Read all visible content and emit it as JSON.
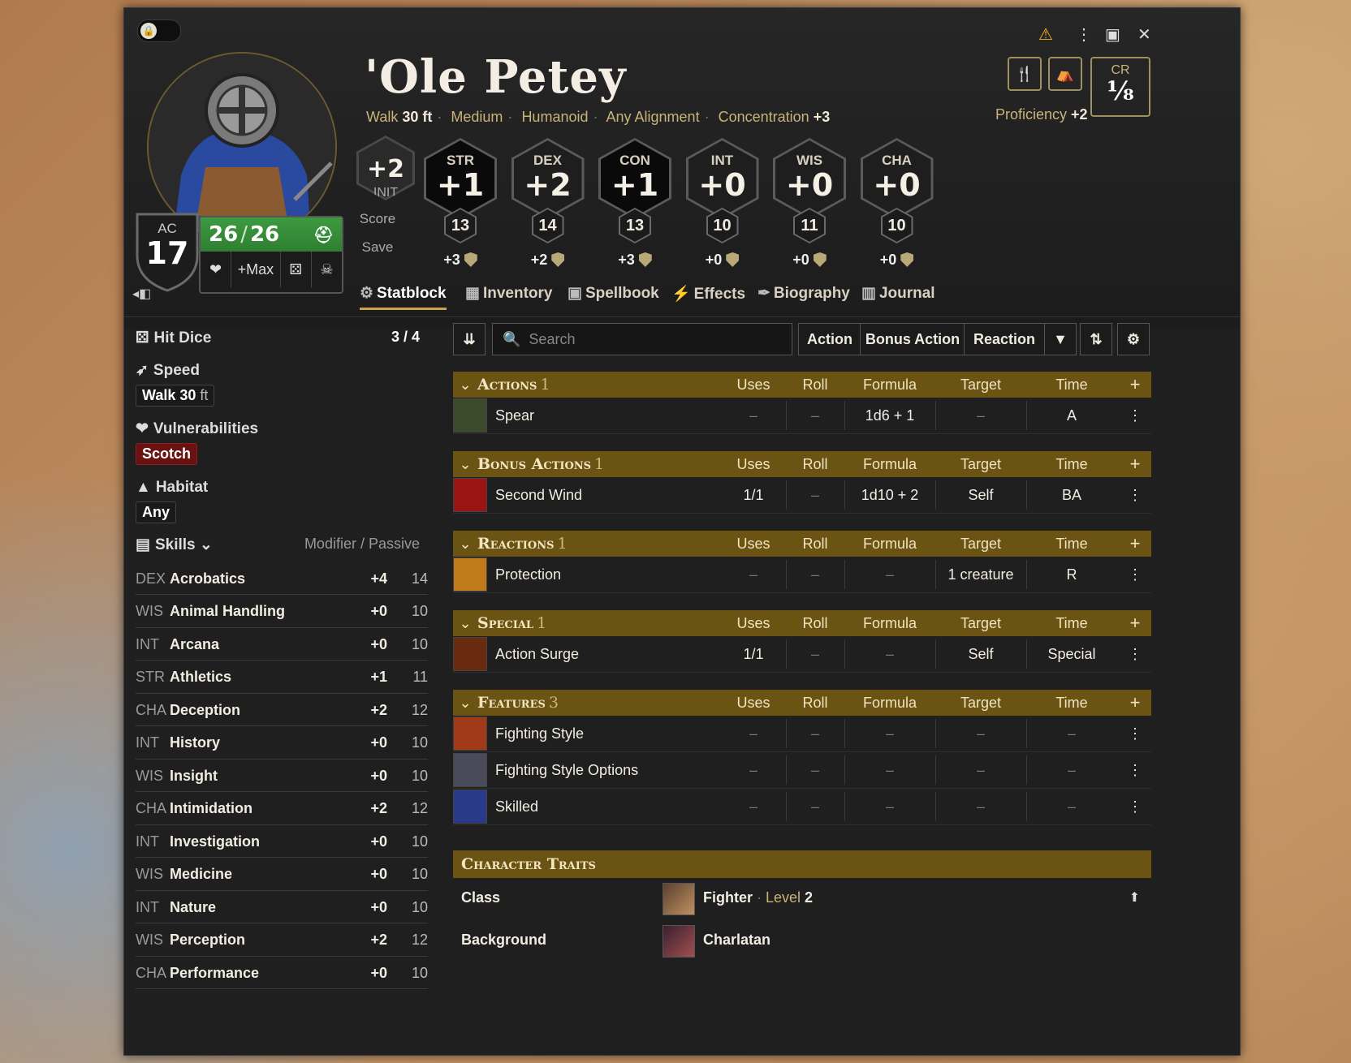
{
  "header": {
    "name": "'Ole Petey",
    "subline": {
      "walk_label": "Walk",
      "walk_value": "30 ft",
      "size": "Medium",
      "type": "Humanoid",
      "alignment": "Any Alignment",
      "concentration_label": "Concentration",
      "concentration_value": "+3"
    },
    "proficiency_label": "Proficiency",
    "proficiency_value": "+2",
    "cr_label": "CR",
    "cr_value": "⅛",
    "ac_label": "AC",
    "ac_value": "17",
    "hp_current": "26",
    "hp_sep": "/",
    "hp_max": "26",
    "hp_max_btn": "+Max",
    "init_value": "+2",
    "init_label": "INIT",
    "score_label": "Score",
    "save_label": "Save",
    "abilities": [
      {
        "abbr": "STR",
        "mod": "+1",
        "score": "13",
        "save": "+3",
        "proficient": true
      },
      {
        "abbr": "DEX",
        "mod": "+2",
        "score": "14",
        "save": "+2",
        "proficient": false
      },
      {
        "abbr": "CON",
        "mod": "+1",
        "score": "13",
        "save": "+3",
        "proficient": true
      },
      {
        "abbr": "INT",
        "mod": "+0",
        "score": "10",
        "save": "+0",
        "proficient": false
      },
      {
        "abbr": "WIS",
        "mod": "+0",
        "score": "11",
        "save": "+0",
        "proficient": false
      },
      {
        "abbr": "CHA",
        "mod": "+0",
        "score": "10",
        "save": "+0",
        "proficient": false
      }
    ]
  },
  "tabs": [
    {
      "label": "Statblock",
      "icon": "gear-icon",
      "active": true
    },
    {
      "label": "Inventory",
      "icon": "backpack-icon"
    },
    {
      "label": "Spellbook",
      "icon": "book-icon"
    },
    {
      "label": "Effects",
      "icon": "bolt-icon"
    },
    {
      "label": "Biography",
      "icon": "feather-icon"
    },
    {
      "label": "Journal",
      "icon": "journal-icon"
    }
  ],
  "sidebar": {
    "hit_dice_label": "Hit Dice",
    "hit_dice_value": "3 / 4",
    "speed_label": "Speed",
    "speed_walk": "Walk",
    "speed_value": "30",
    "speed_unit": "ft",
    "vulnerabilities_label": "Vulnerabilities",
    "vulnerability": "Scotch",
    "habitat_label": "Habitat",
    "habitat": "Any",
    "skills_label": "Skills",
    "skills_cols": "Modifier / Passive",
    "skills": [
      {
        "ab": "DEX",
        "name": "Acrobatics",
        "mod": "+4",
        "passive": "14"
      },
      {
        "ab": "WIS",
        "name": "Animal Handling",
        "mod": "+0",
        "passive": "10"
      },
      {
        "ab": "INT",
        "name": "Arcana",
        "mod": "+0",
        "passive": "10"
      },
      {
        "ab": "STR",
        "name": "Athletics",
        "mod": "+1",
        "passive": "11"
      },
      {
        "ab": "CHA",
        "name": "Deception",
        "mod": "+2",
        "passive": "12"
      },
      {
        "ab": "INT",
        "name": "History",
        "mod": "+0",
        "passive": "10"
      },
      {
        "ab": "WIS",
        "name": "Insight",
        "mod": "+0",
        "passive": "10"
      },
      {
        "ab": "CHA",
        "name": "Intimidation",
        "mod": "+2",
        "passive": "12"
      },
      {
        "ab": "INT",
        "name": "Investigation",
        "mod": "+0",
        "passive": "10"
      },
      {
        "ab": "WIS",
        "name": "Medicine",
        "mod": "+0",
        "passive": "10"
      },
      {
        "ab": "INT",
        "name": "Nature",
        "mod": "+0",
        "passive": "10"
      },
      {
        "ab": "WIS",
        "name": "Perception",
        "mod": "+2",
        "passive": "12"
      },
      {
        "ab": "CHA",
        "name": "Performance",
        "mod": "+0",
        "passive": "10"
      }
    ]
  },
  "toolbar": {
    "search_placeholder": "Search",
    "filters": [
      "Action",
      "Bonus Action",
      "Reaction"
    ]
  },
  "columns": {
    "uses": "Uses",
    "roll": "Roll",
    "formula": "Formula",
    "target": "Target",
    "time": "Time"
  },
  "sections": [
    {
      "title": "Actions",
      "count": "1",
      "items": [
        {
          "name": "Spear",
          "uses": "–",
          "roll": "–",
          "formula": "1d6 + 1",
          "target": "–",
          "time": "A",
          "icon_color": "#3b4a2a"
        }
      ]
    },
    {
      "title": "Bonus Actions",
      "count": "1",
      "items": [
        {
          "name": "Second Wind",
          "uses": "1/1",
          "roll": "–",
          "formula": "1d10 + 2",
          "target": "Self",
          "time": "BA",
          "icon_color": "#9a1414"
        }
      ]
    },
    {
      "title": "Reactions",
      "count": "1",
      "items": [
        {
          "name": "Protection",
          "uses": "–",
          "roll": "–",
          "formula": "–",
          "target": "1 creature",
          "time": "R",
          "icon_color": "#c07a1a"
        }
      ]
    },
    {
      "title": "Special",
      "count": "1",
      "items": [
        {
          "name": "Action Surge",
          "uses": "1/1",
          "roll": "–",
          "formula": "–",
          "target": "Self",
          "time": "Special",
          "icon_color": "#6a2a10"
        }
      ]
    },
    {
      "title": "Features",
      "count": "3",
      "items": [
        {
          "name": "Fighting Style",
          "uses": "–",
          "roll": "–",
          "formula": "–",
          "target": "–",
          "time": "–",
          "icon_color": "#a03a18"
        },
        {
          "name": "Fighting Style Options",
          "uses": "–",
          "roll": "–",
          "formula": "–",
          "target": "–",
          "time": "–",
          "icon_color": "#4a4a5a"
        },
        {
          "name": "Skilled",
          "uses": "–",
          "roll": "–",
          "formula": "–",
          "target": "–",
          "time": "–",
          "icon_color": "#2a3a8a"
        }
      ]
    }
  ],
  "traits": {
    "title": "Character Traits",
    "class_label": "Class",
    "class_value": "Fighter",
    "class_level": "Level",
    "class_level_value": "2",
    "background_label": "Background",
    "background_value": "Charlatan"
  },
  "colors": {
    "accent_gold": "#6b5314",
    "hp_green": "#3d9a3f",
    "vuln_red": "#6a1212",
    "warning": "#f0b020"
  }
}
